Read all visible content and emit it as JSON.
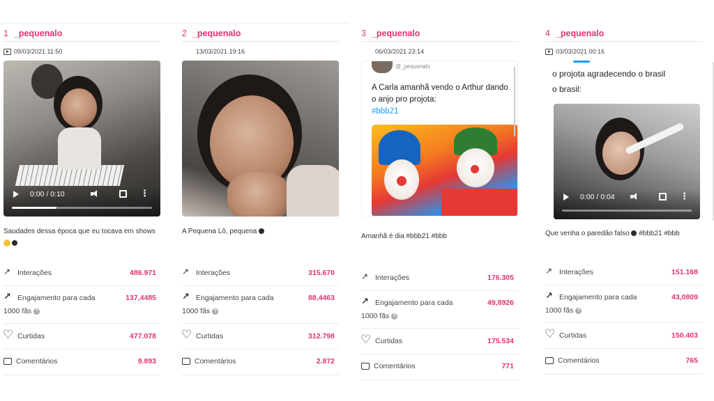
{
  "cards": [
    {
      "rank": "1",
      "user": "_pequenalo",
      "date": "09/03/2021 11:50",
      "video_time": "0:00 / 0:10",
      "caption": "Saudades dessa época que eu tocava em shows",
      "stats": {
        "interactions_label": "Interações",
        "interactions": "486.971",
        "engagement_label": "Engajamento para cada",
        "engagement_sub": "1000 fãs",
        "engagement": "137,4485",
        "likes_label": "Curtidas",
        "likes": "477.078",
        "comments_label": "Comentários",
        "comments": "9.893"
      }
    },
    {
      "rank": "2",
      "user": "_pequenalo",
      "date": "13/03/2021 19:16",
      "caption": "A Pequena Lô, pequena",
      "stats": {
        "interactions_label": "Interações",
        "interactions": "315.670",
        "engagement_label": "Engajamento para cada",
        "engagement_sub": "1000 fãs",
        "engagement": "88,4463",
        "likes_label": "Curtidas",
        "likes": "312.798",
        "comments_label": "Comentários",
        "comments": "2.872"
      }
    },
    {
      "rank": "3",
      "user": "_pequenalo",
      "date": "06/03/2021 23:14",
      "tweet_handle": "@_pequenalo",
      "tweet_text": "A Carla amanhã vendo o Arthur dando o anjo pro projota:",
      "tweet_tag": "#bbb21",
      "caption": "Amanhã é dia #bbb21 #bbb",
      "stats": {
        "interactions_label": "Interações",
        "interactions": "176.305",
        "engagement_label": "Engajamento para cada",
        "engagement_sub": "1000 fãs",
        "engagement": "49,8926",
        "likes_label": "Curtidas",
        "likes": "175.534",
        "comments_label": "Comentários",
        "comments": "771"
      }
    },
    {
      "rank": "4",
      "user": "_pequenalo",
      "date": "03/03/2021 00:16",
      "tweet_line1": "o projota agradecendo o brasil",
      "tweet_line2": "o brasil:",
      "video_time": "0:00 / 0:04",
      "caption": "Que venha o paredão falso",
      "caption_tags": "#bbb21 #bbb",
      "stats": {
        "interactions_label": "Interações",
        "interactions": "151.168",
        "engagement_label": "Engajamento para cada",
        "engagement_sub": "1000 fãs",
        "engagement": "43,0809",
        "likes_label": "Curtidas",
        "likes": "150.403",
        "comments_label": "Comentários",
        "comments": "765"
      }
    }
  ],
  "colors": {
    "accent": "#e2336b",
    "text": "#333333",
    "divider": "#e8e8e8"
  },
  "icons": [
    "video-icon",
    "trend-icon",
    "engagement-icon",
    "heart-icon",
    "comment-icon",
    "help-icon",
    "play-icon",
    "volume-icon",
    "fullscreen-icon",
    "more-icon"
  ]
}
